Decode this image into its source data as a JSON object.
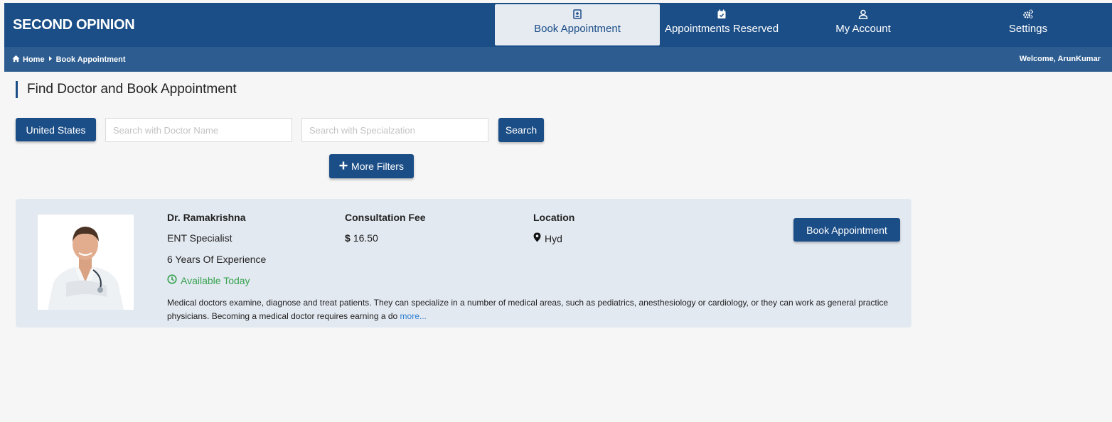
{
  "app": {
    "brand": "SECOND OPINION"
  },
  "nav": [
    {
      "label": "Book Appointment",
      "icon": "contact-card-icon",
      "active": true
    },
    {
      "label": "Appointments Reserved",
      "icon": "calendar-check-icon",
      "active": false
    },
    {
      "label": "My Account",
      "icon": "user-icon",
      "active": false
    },
    {
      "label": "Settings",
      "icon": "gears-icon",
      "active": false
    }
  ],
  "breadcrumb": {
    "home": "Home",
    "current": "Book Appointment"
  },
  "welcome": "Welcome, ArunKumar",
  "page": {
    "title": "Find Doctor and Book Appointment"
  },
  "search": {
    "country": "United States",
    "doctor_placeholder": "Search with Doctor Name",
    "doctor_value": "",
    "spec_placeholder": "Search with Specialzation",
    "spec_value": "",
    "search_label": "Search",
    "more_filters_label": "More Filters"
  },
  "doctor": {
    "name": "Dr. Ramakrishna",
    "specialization": "ENT Specialist",
    "experience": "6 Years Of Experience",
    "availability": "Available Today",
    "fee_label": "Consultation Fee",
    "fee_currency": "$",
    "fee_value": "16.50",
    "location_label": "Location",
    "location": "Hyd",
    "book_label": "Book Appointment",
    "description": "Medical doctors examine, diagnose and treat patients. They can specialize in a number of medical areas, such as pediatrics, anesthesiology or cardiology, or they can work as general practice physicians. Becoming a medical doctor requires earning a do",
    "more_label": "more..."
  },
  "colors": {
    "primary": "#1b4e87",
    "breadcrumb_bar": "#2d5d90",
    "card_bg": "#e3e9f1",
    "available": "#36a24f",
    "link": "#2f7fd0"
  }
}
